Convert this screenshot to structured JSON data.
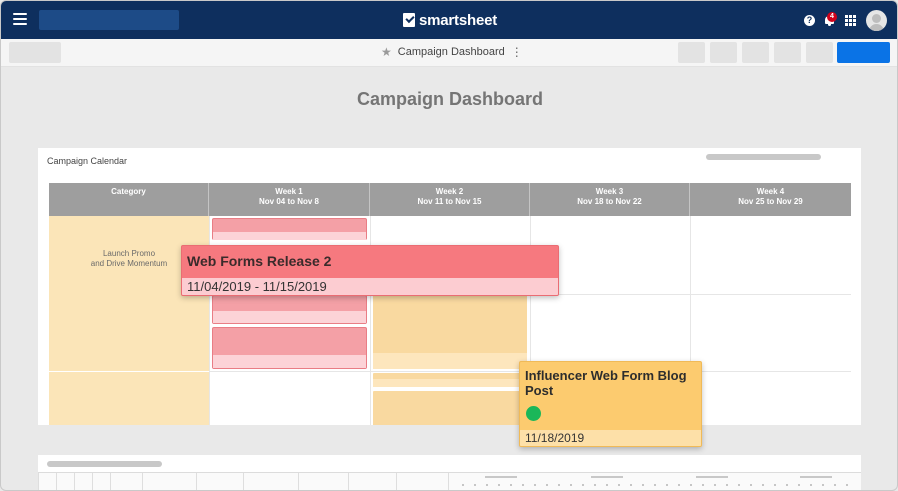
{
  "app": {
    "brand": "smartsheet",
    "notification_count": "4",
    "help_glyph": "?"
  },
  "toolbar": {
    "title": "Campaign Dashboard",
    "star_icon": "★",
    "more_icon": "⋮",
    "primary_color": "#0a73e6"
  },
  "page": {
    "title": "Campaign Dashboard"
  },
  "calendar": {
    "title": "Campaign Calendar",
    "columns": [
      {
        "label": "Category",
        "sub": ""
      },
      {
        "label": "Week 1",
        "sub": "Nov 04 to Nov 8"
      },
      {
        "label": "Week 2",
        "sub": "Nov 11 to Nov 15"
      },
      {
        "label": "Week 3",
        "sub": "Nov 18 to Nov 22"
      },
      {
        "label": "Week 4",
        "sub": "Nov 25 to Nov 29"
      }
    ],
    "category_line1": "Launch Promo",
    "category_line2": "and Drive Momentum"
  },
  "cards": {
    "red": {
      "title": "Web Forms Release 2",
      "dates": "11/04/2019 - 11/15/2019",
      "color": "#f6797f"
    },
    "orange": {
      "title": "Influencer Web Form Blog Post",
      "date": "11/18/2019",
      "status": "green",
      "color": "#fccb6f"
    }
  }
}
